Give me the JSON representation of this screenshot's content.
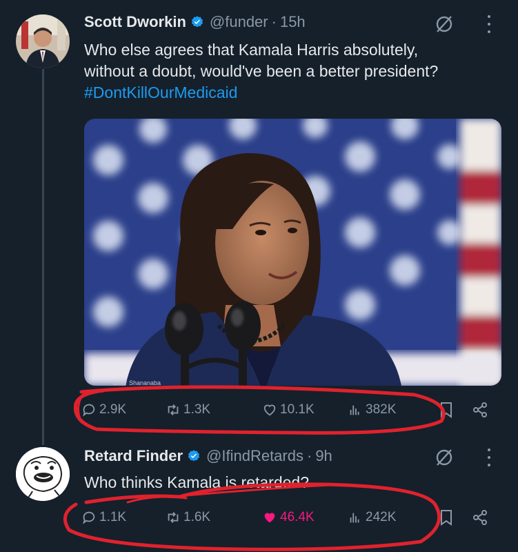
{
  "tweets": [
    {
      "name": "Scott Dworkin",
      "handle": "@funder",
      "separator": "·",
      "time": "15h",
      "text_line1": "Who else agrees that Kamala Harris absolutely,",
      "text_line2": "without a doubt, would've been a better president?",
      "hashtag": "#DontKillOurMedicaid",
      "media_watermark": "umer Shananaba",
      "actions": {
        "replies": "2.9K",
        "reposts": "1.3K",
        "likes": "10.1K",
        "views": "382K"
      },
      "liked": false
    },
    {
      "name": "Retard Finder",
      "handle": "@IfindRetards",
      "separator": "·",
      "time": "9h",
      "text_line1": "Who thinks Kamala is retarded?",
      "actions": {
        "replies": "1.1K",
        "reposts": "1.6K",
        "likes": "46.4K",
        "views": "242K"
      },
      "liked": true
    }
  ],
  "colors": {
    "background": "#15202b",
    "link": "#1d9bf0",
    "muted": "#8b98a5",
    "like": "#f91880",
    "annotation": "#e0222d"
  }
}
